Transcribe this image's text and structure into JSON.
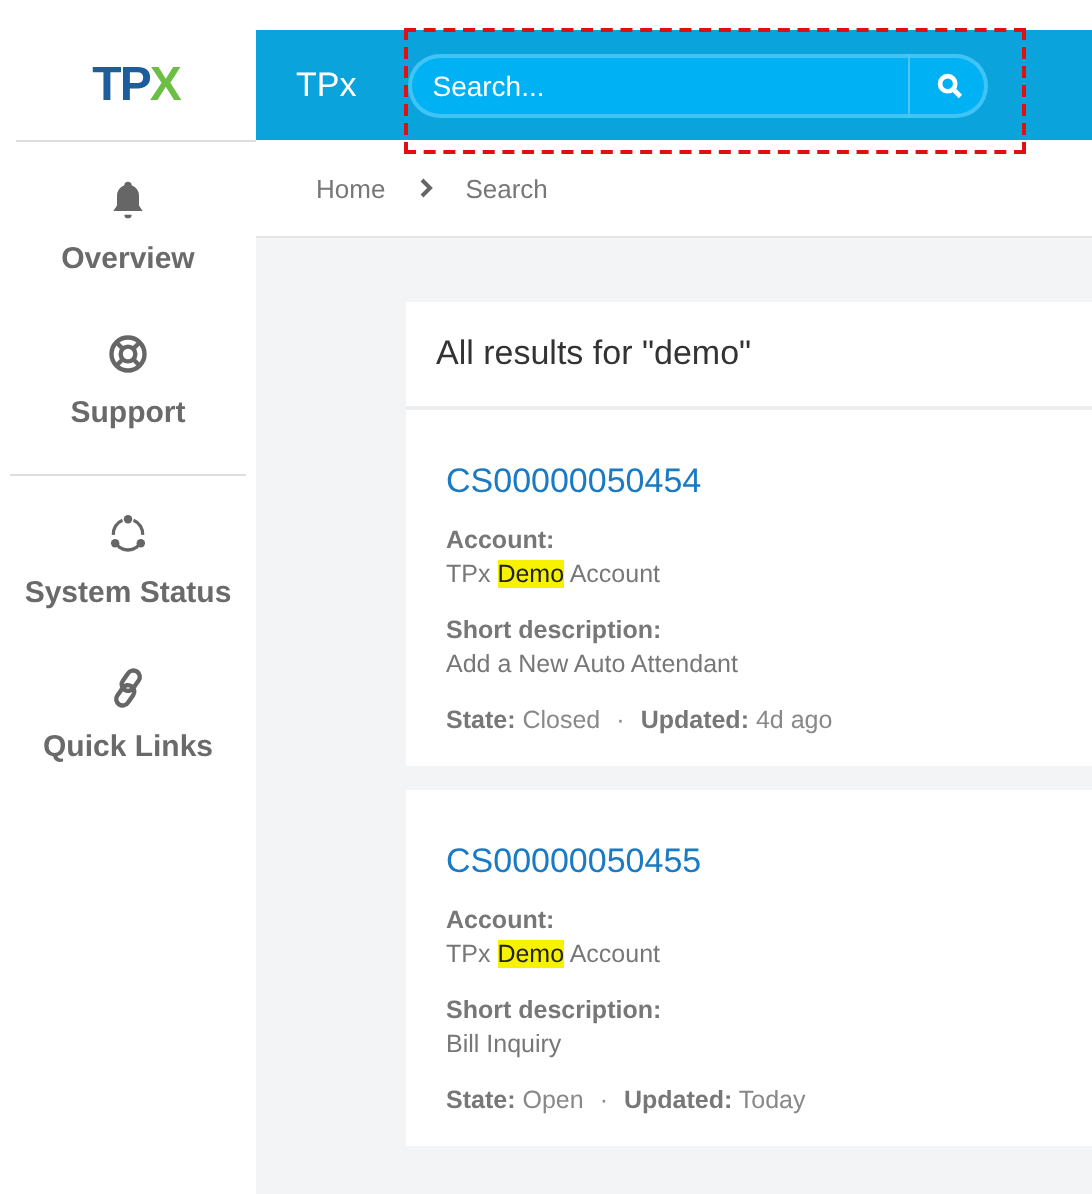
{
  "logo": {
    "text": "TP",
    "accent": "X"
  },
  "header": {
    "title": "TPx",
    "search": {
      "placeholder": "Search..."
    }
  },
  "sidebar": {
    "items": [
      {
        "label": "Overview",
        "kind": "bell"
      },
      {
        "label": "Support",
        "kind": "lifebuoy"
      },
      {
        "label": "System Status",
        "kind": "cycle"
      },
      {
        "label": "Quick Links",
        "kind": "link"
      }
    ]
  },
  "breadcrumb": [
    "Home",
    "Search"
  ],
  "results": {
    "title": "All results for \"demo\"",
    "items": [
      {
        "number": "CS00000050454",
        "account_label": "Account:",
        "account": [
          {
            "text": "TPx ",
            "highlight": false
          },
          {
            "text": "Demo",
            "highlight": true
          },
          {
            "text": " Account",
            "highlight": false
          }
        ],
        "description_label": "Short description:",
        "description": "Add a New Auto Attendant",
        "state_label": "State:",
        "state": "Closed",
        "separator": "·",
        "updated_label": "Updated:",
        "updated": "4d ago"
      },
      {
        "number": "CS00000050455",
        "account_label": "Account:",
        "account": [
          {
            "text": "TPx ",
            "highlight": false
          },
          {
            "text": "Demo",
            "highlight": true
          },
          {
            "text": " Account",
            "highlight": false
          }
        ],
        "description_label": "Short description:",
        "description": "Bill Inquiry",
        "state_label": "State:",
        "state": "Open",
        "separator": "·",
        "updated_label": "Updated:",
        "updated": "Today"
      }
    ]
  }
}
